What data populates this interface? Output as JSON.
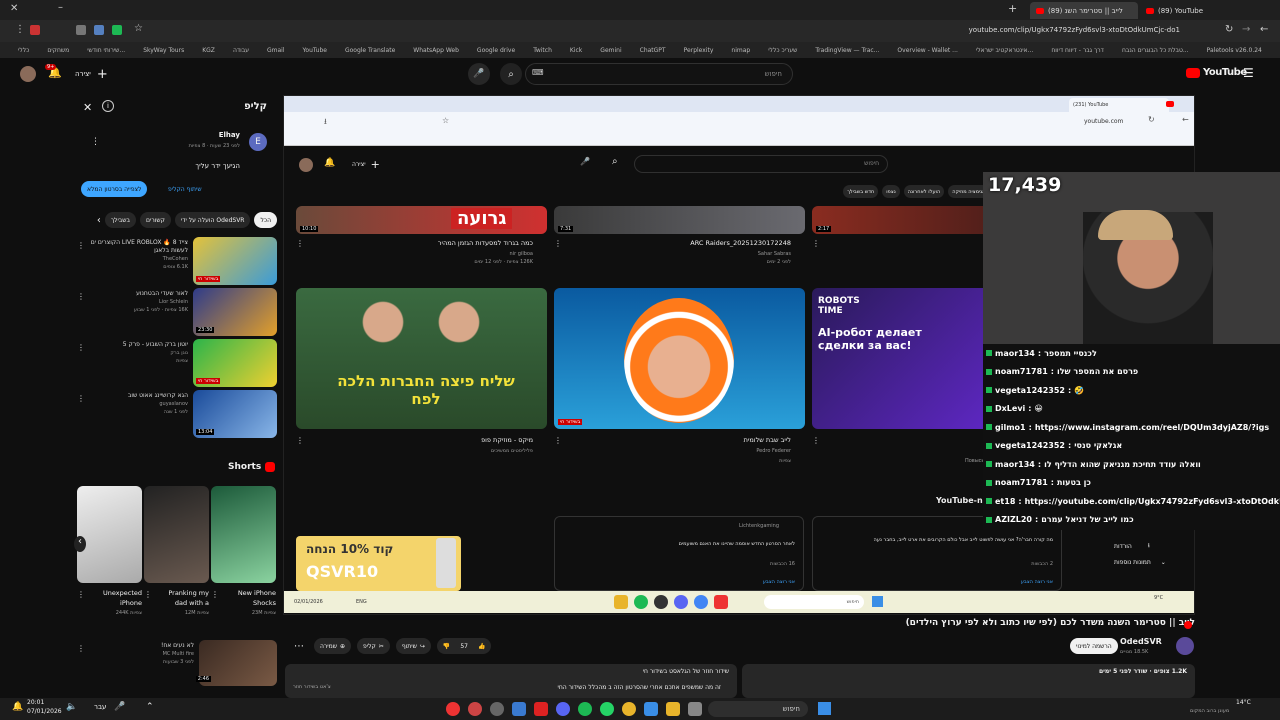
{
  "browser": {
    "tabs": [
      {
        "label": "(89) YouTube",
        "active": false
      },
      {
        "label": "לייב || סטרימר השנ (89)",
        "active": true
      }
    ],
    "url": "youtube.com/clip/Ugkx74792zFyd6svl3-xtoDtOdkUmCjc-do1",
    "bookmarks": [
      "Paletools v26.0.24",
      "טבלת כל הבוגרים הנבח...",
      "דרך גבר - דיווח דיווח",
      "אינטראקטיב ישראלי...",
      "Overview - Wallet ...",
      "TradingView — Trac...",
      "שעריכ כללי",
      "nimap",
      "Perplexity",
      "ChatGPT",
      "Gemini",
      "Kick",
      "Twitch",
      "Google drive",
      "WhatsApp Web",
      "Google Translate",
      "YouTube",
      "Gmail",
      "עבודה",
      "KGZ",
      "SkyWay Tours",
      "שירותי חודשי...",
      "משחקים",
      "כללי"
    ]
  },
  "yt": {
    "logo": "YouTube",
    "search_placeholder": "חיפוש",
    "create_label": "יצירה",
    "notif_count": "9+"
  },
  "clip_panel": {
    "title": "קליפ",
    "creator": "Elhay",
    "meta": "לפני 23 שעות · 8 צפיות",
    "text": "הגיעך ידר עליך",
    "watch_full": "לצפייה בסרטון המלא",
    "share_clip": "שיתוף הקליפ",
    "avatar_letter": "E"
  },
  "filter_chips": [
    "הכל",
    "הועלה על ידי OdedSVR",
    "קשורים",
    "בשבילך"
  ],
  "side_videos": [
    {
      "title": "צייד 8 🔥 LIVE ROBLOX הקוצרים ים לעשות בלאגן",
      "channel": "TheCohen",
      "meta": "6.1K צופים",
      "badge": "בשידור חי"
    },
    {
      "title": "לאור שעדי הבטחנוע",
      "channel": "Lior Schlein",
      "meta": "16K צפיות · לפני 1 שבוע",
      "badge": "23:30"
    },
    {
      "title": "יוטון ברק השבוע - פרק 5",
      "channel": "נוגן ברק",
      "meta": "צפיות",
      "badge": "בשידור חי"
    },
    {
      "title": "הגא קרושיינג אאוט שוב",
      "channel": "guyaslanov",
      "meta": "לפני 1 שנה",
      "badge": "13:04"
    }
  ],
  "shorts": {
    "heading": "Shorts",
    "items": [
      {
        "title": "New iPhone Shocks",
        "views": "23M צפיות"
      },
      {
        "title": "Pranking my dad with a",
        "views": "12M צפיות"
      },
      {
        "title": "Unexpected iPhone",
        "views": "244K צפיות"
      }
    ]
  },
  "lower_side": {
    "title": "לא נעים אח!",
    "channel": "MC Multi fire",
    "meta": "לפני 3 שבועות",
    "badge": "2:46"
  },
  "inner": {
    "search_placeholder": "חיפוש",
    "create_label": "יצירה",
    "tab_label": "(231) YouTube",
    "url": "youtube.com",
    "chips": [
      "הכל",
      "שידורי חי",
      "מיקסים",
      "משחקי פעולה והרפתקאות",
      "גיימינג",
      "סכוג",
      "אנימציה מוזיקה",
      "הועלו לאחרונה",
      "נצפו",
      "חדש בשבילך"
    ],
    "row1": [
      {
        "title": "Biggest red",
        "meta": "",
        "duration": "2:17"
      },
      {
        "title": "ARC Raiders_20251230172248",
        "channel": "Sahar Sabras",
        "meta": "לפני 2 ימים",
        "duration": "7:31"
      },
      {
        "title": "כמה בגרוד למסעדות הגזמן המהיר",
        "channel": "nir gilboa",
        "meta": "126K צפיות · לפני 12 ימים",
        "duration": "10:10",
        "overlay": "גרועה"
      }
    ],
    "row2": [
      {
        "title": "Быстр",
        "meta": "Повысьте свой капитал с AI-бот",
        "overlay1": "ROBOTS TIME",
        "overlay2": "AI-робот делает сделки за вас!"
      },
      {
        "title": "לייב שבת שלומית",
        "channel": "Pedro Federer",
        "meta": "צפיות",
        "badge": "בשידור חי"
      },
      {
        "title": "מיקס - מוזיקת פופ",
        "channel": "פליליסטים ממשיכים",
        "meta": "",
        "overlay": "שליח פיצה החברות הלכה לפח"
      }
    ],
    "community1": {
      "channel": "Lichtenkgaming",
      "text": "לאחר הסרטון החדש אוסמה שהיינו את האנם משועמים",
      "meta": "16 הכבשות",
      "cta": "אני רוצה הצבע"
    },
    "community2": {
      "text": "מה קורה חבר'ה? אני עושה לפשוט לייב אבל כולם הקרובים את ארט לייב, בחבר נעה",
      "meta": "2 הכבשות",
      "cta": "אני רוצה הצבע"
    },
    "ad": {
      "text": "QSVR10",
      "subtitle": "קוד 10% הנחה"
    },
    "youtube_news": "YouTube-n",
    "downloads": "הורדות",
    "more": "תמונות נוספות"
  },
  "inner_taskbar": {
    "date": "02/01/2026",
    "lang": "ENG",
    "search": "חיפוש",
    "weather": "9°C"
  },
  "stream": {
    "viewer_count": "17,439",
    "chat": [
      {
        "user": "maor134",
        "msg": "לכנסיי תמספר"
      },
      {
        "user": "noam71781",
        "msg": "פרסם את המספר שלו"
      },
      {
        "user": "vegeta1242352",
        "msg": "🤣"
      },
      {
        "user": "DxLevi",
        "msg": "😀"
      },
      {
        "user": "gilmo1",
        "msg": "https://www.instagram.com/reel/DQUm3dyjAZ8/?igs"
      },
      {
        "user": "vegeta1242352",
        "msg": "אגלאקי סנסי"
      },
      {
        "user": "maor134",
        "msg": "וואלה עודד תחיכת מגניאק שהוא הדליף לו"
      },
      {
        "user": "noam71781",
        "msg": "כן בטעות"
      },
      {
        "user": "et18",
        "msg": "https://youtube.com/clip/Ugkx74792zFyd6svl3-xtoDtOdkUmCjc"
      },
      {
        "user": "AZIZL20",
        "msg": "כמו לייב של דניאל עמרם"
      }
    ]
  },
  "video_info": {
    "title": "לייב || סטרימר השנה משדר לכם (לפי שיו כתוב ולא לפי ערוץ הילדים)",
    "channel": "OdedSVR",
    "subs": "18.5K מנויים",
    "subscribe": "הרשמה למינוי",
    "likes": "57",
    "share": "שיתוף",
    "clip": "קליפ",
    "save": "שמירה",
    "views_meta": "1.2K צופים · שודר לפני 5 ימים",
    "pinned": "שידור חוזר של הגלאסט בשידור חי",
    "desc": "זה מה שמשפים אתכם אחרי שהסרטון הזה ב מהכלל השידור החי",
    "comments_label": "צ'אט בשידור חוזר"
  },
  "os_taskbar": {
    "time": "20:01",
    "date": "07/01/2026",
    "lang": "עבר",
    "search": "חיפוש",
    "weather": "14°C",
    "weather_note": "מעונן ברוב המקום"
  },
  "colors": {
    "accent": "#ff0000",
    "bg": "#0f0f0f",
    "chip": "#272727",
    "link": "#3ea6ff"
  }
}
